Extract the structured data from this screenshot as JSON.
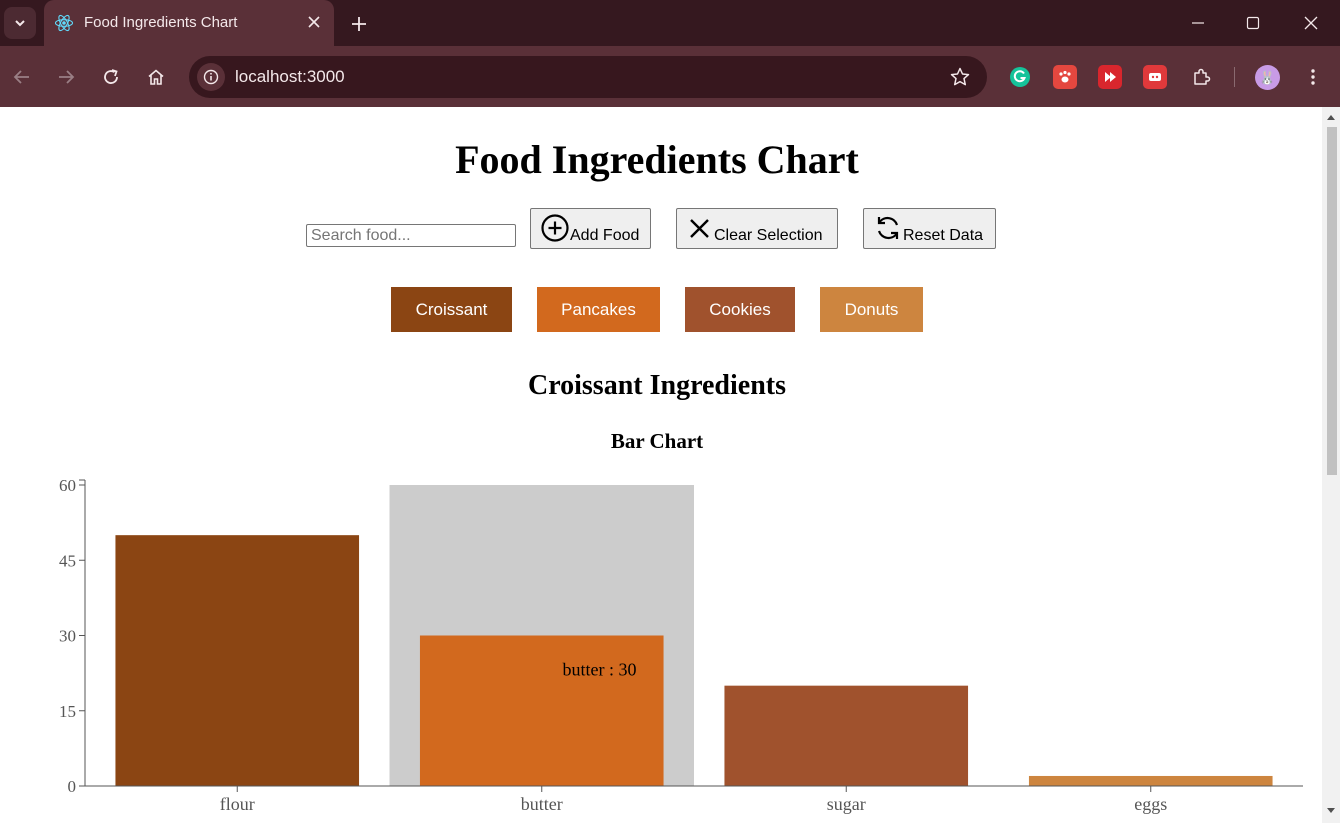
{
  "browser": {
    "tab_title": "Food Ingredients Chart",
    "url": "localhost:3000"
  },
  "page": {
    "title": "Food Ingredients Chart",
    "search_placeholder": "Search food...",
    "buttons": {
      "add": "Add Food",
      "clear": "Clear Selection",
      "reset": "Reset Data"
    },
    "foods": [
      {
        "label": "Croissant",
        "color": "#8b4513"
      },
      {
        "label": "Pancakes",
        "color": "#d2691e"
      },
      {
        "label": "Cookies",
        "color": "#a0522d"
      },
      {
        "label": "Donuts",
        "color": "#cd853f"
      }
    ],
    "chart_heading": "Croissant Ingredients",
    "chart_subheading": "Bar Chart"
  },
  "chart_data": {
    "type": "bar",
    "categories": [
      "flour",
      "butter",
      "sugar",
      "eggs"
    ],
    "values": [
      50,
      30,
      20,
      2
    ],
    "colors": [
      "#8b4513",
      "#d2691e",
      "#a0522d",
      "#cd853f"
    ],
    "ylim": [
      0,
      60
    ],
    "yticks": [
      0,
      15,
      30,
      45,
      60
    ],
    "highlighted": "butter",
    "tooltip": "butter : 30",
    "highlight_color": "#cccccc"
  }
}
